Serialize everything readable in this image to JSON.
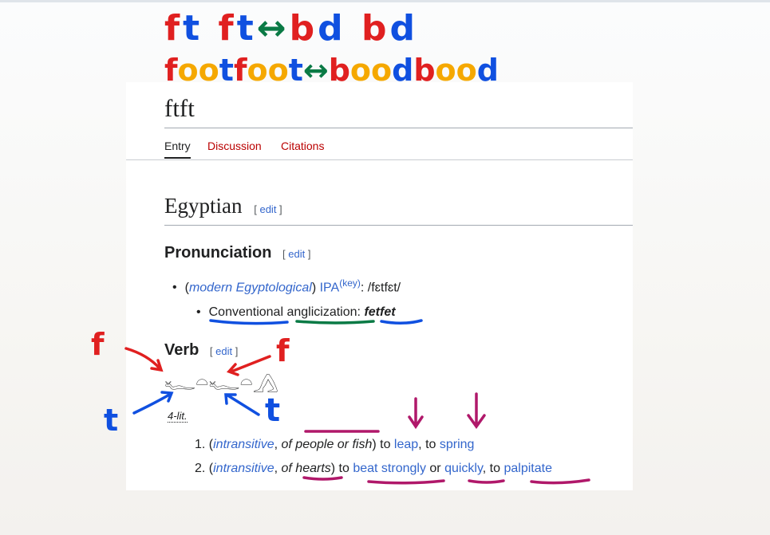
{
  "page": {
    "title": "ftft",
    "tabs": [
      {
        "label": "Entry",
        "active": true
      },
      {
        "label": "Discussion"
      },
      {
        "label": "Citations"
      }
    ]
  },
  "sections": {
    "language": "Egyptian",
    "edit": "[ edit ]",
    "pronunciation": {
      "heading": "Pronunciation",
      "qualifier": "modern Egyptological",
      "ipa_label": "IPA",
      "key": "(key)",
      "ipa": ": /fɛtfɛt/",
      "conv_label": "Conventional",
      "anglicization_label": "anglicization",
      "colon": ":",
      "anglicization": "fetfet"
    },
    "verb": {
      "heading": "Verb",
      "hieroglyphs": "𓆑𓏏𓆑𓏏𓂻",
      "class": "4-lit.",
      "definitions": [
        {
          "n": "1.",
          "parts": [
            "(",
            "intransitive",
            ", ",
            "of people or fish",
            ") to ",
            "leap",
            ", to ",
            "spring"
          ]
        },
        {
          "n": "2.",
          "parts": [
            "(",
            "intransitive",
            ", ",
            "of ",
            "hearts",
            ") to ",
            "beat strongly",
            " or ",
            "quickly",
            ", to ",
            "palpitate"
          ]
        }
      ]
    }
  },
  "annotations": {
    "row1": [
      "f",
      "t",
      "f",
      "t",
      "↔",
      "b",
      "d",
      "b",
      "d"
    ],
    "row2": [
      "f",
      "oo",
      "t",
      "f",
      "oo",
      "t",
      "↔",
      "b",
      "oo",
      "d",
      "b",
      "oo",
      "d"
    ],
    "side_f": "f",
    "side_t": "t"
  },
  "colors": {
    "link": "#3366cc",
    "red_link": "#ba0000",
    "ann_red": "#e02020",
    "ann_blue": "#1050e0",
    "ann_green": "#0a7a45",
    "ann_orange": "#f5a800",
    "ann_purple": "#b0186a"
  }
}
